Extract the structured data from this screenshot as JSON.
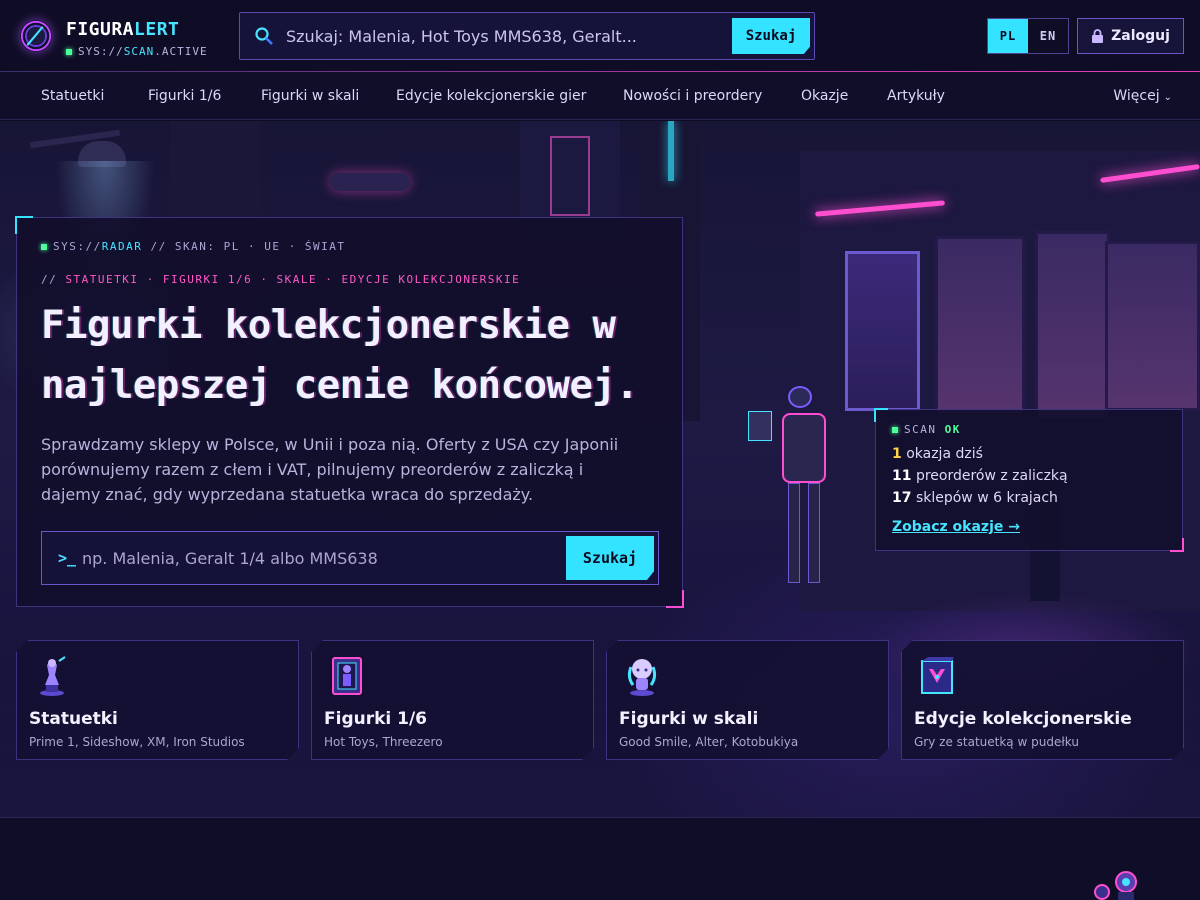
{
  "header": {
    "brand_part1": "FIGURA",
    "brand_part2": "LERT",
    "sys_prefix": "SYS://",
    "sys_highlight": "SCAN",
    "sys_suffix": ".ACTIVE",
    "search_placeholder": "Szukaj: Malenia, Hot Toys MMS638, Geralt...",
    "search_button": "Szukaj",
    "lang_active": "PL",
    "lang_other": "EN",
    "login_label": "Zaloguj"
  },
  "nav": {
    "items": [
      "Statuetki",
      "Figurki 1/6",
      "Figurki w skali",
      "Edycje kolekcjonerskie gier",
      "Nowości i preordery",
      "Okazje",
      "Artykuły"
    ],
    "more": "Więcej"
  },
  "hero": {
    "sys_prefix": "SYS://",
    "sys_highlight": "RADAR",
    "sys_suffix": " // SKAN: PL · UE · ŚWIAT",
    "cats_prefix": "// ",
    "cats": "STATUETKI · FIGURKI 1/6 · SKALE · EDYCJE KOLEKCJONERSKIE",
    "title_line1": "Figurki kolekcjonerskie w",
    "title_line2": "najlepszej cenie końcowej.",
    "description": "Sprawdzamy sklepy w Polsce, w Unii i poza nią. Oferty z USA czy Japonii porównujemy razem z cłem i VAT, pilnujemy preorderów z zaliczką i dajemy znać, gdy wyprzedana statuetka wraca do sprzedaży.",
    "search_prompt": ">_",
    "search_placeholder": "np. Malenia, Geralt 1/4 albo MMS638",
    "search_button": "Szukaj"
  },
  "scan": {
    "label": "SCAN",
    "status": "OK",
    "lines": [
      {
        "num": "1",
        "text": "okazja dziś"
      },
      {
        "num": "11",
        "text": "preorderów z zaliczką"
      },
      {
        "num": "17",
        "text": "sklepów w 6 krajach"
      }
    ],
    "link": "Zobacz okazje →"
  },
  "tiles": [
    {
      "title": "Statuetki",
      "subtitle": "Prime 1, Sideshow, XM, Iron Studios",
      "icon": "statue-icon"
    },
    {
      "title": "Figurki 1/6",
      "subtitle": "Hot Toys, Threezero",
      "icon": "boxed-figure-icon"
    },
    {
      "title": "Figurki w skali",
      "subtitle": "Good Smile, Alter, Kotobukiya",
      "icon": "chibi-figure-icon"
    },
    {
      "title": "Edycje kolekcjonerskie",
      "subtitle": "Gry ze statuetką w pudełku",
      "icon": "collector-box-icon"
    }
  ],
  "colors": {
    "accent_cyan": "#33e3ff",
    "accent_magenta": "#ff4fd0",
    "status_green": "#4dff9a",
    "background": "#0e0c22"
  }
}
